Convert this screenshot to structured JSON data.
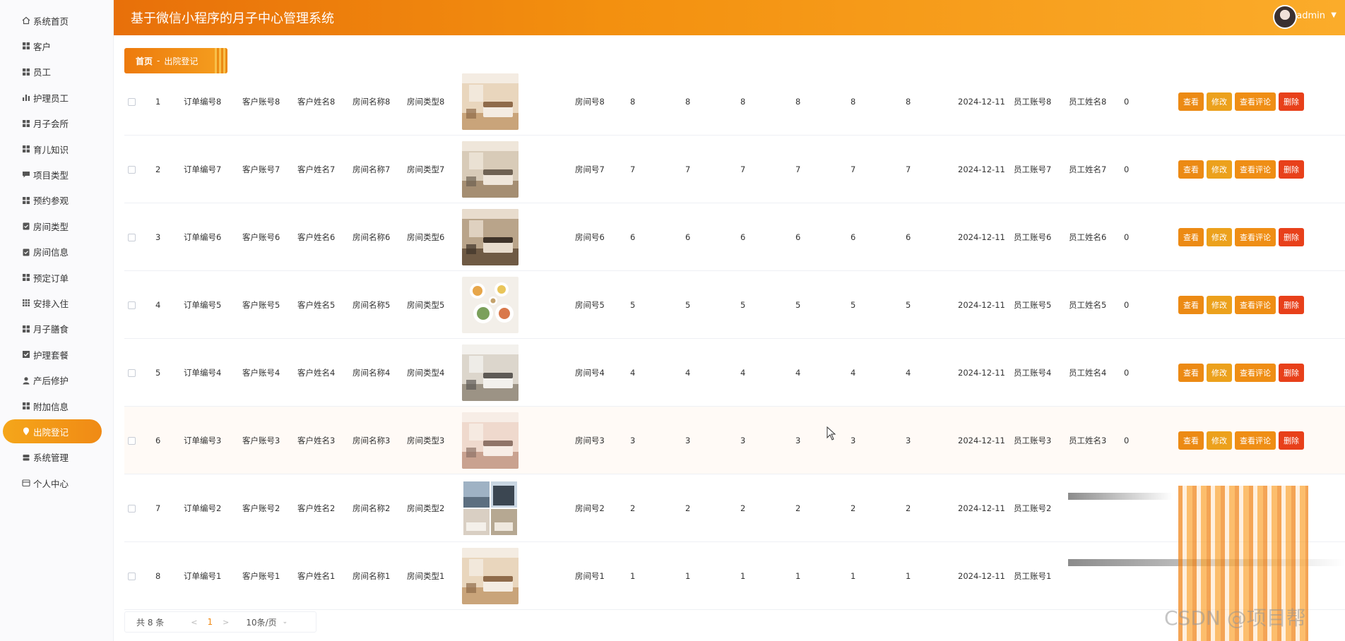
{
  "header": {
    "title": "基于微信小程序的月子中心管理系统",
    "user": "admin"
  },
  "sidebar": {
    "items": [
      {
        "label": "系统首页",
        "icon": "home-icon"
      },
      {
        "label": "客户",
        "icon": "grid-icon"
      },
      {
        "label": "员工",
        "icon": "grid-icon"
      },
      {
        "label": "护理员工",
        "icon": "bar-chart-icon"
      },
      {
        "label": "月子会所",
        "icon": "grid-icon"
      },
      {
        "label": "育儿知识",
        "icon": "grid-icon"
      },
      {
        "label": "项目类型",
        "icon": "chat-icon"
      },
      {
        "label": "预约参观",
        "icon": "grid-icon"
      },
      {
        "label": "房间类型",
        "icon": "clipboard-icon"
      },
      {
        "label": "房间信息",
        "icon": "clipboard-icon"
      },
      {
        "label": "预定订单",
        "icon": "grid-icon"
      },
      {
        "label": "安排入住",
        "icon": "grid9-icon"
      },
      {
        "label": "月子膳食",
        "icon": "grid-icon"
      },
      {
        "label": "护理套餐",
        "icon": "checkbox-icon"
      },
      {
        "label": "产后修护",
        "icon": "user-icon"
      },
      {
        "label": "附加信息",
        "icon": "grid-icon"
      },
      {
        "label": "出院登记",
        "icon": "pin-icon"
      },
      {
        "label": "系统管理",
        "icon": "server-icon"
      },
      {
        "label": "个人中心",
        "icon": "card-icon"
      }
    ],
    "active_index": 16
  },
  "breadcrumb": {
    "home": "首页",
    "separator": "-",
    "current": "出院登记"
  },
  "table": {
    "rows": [
      {
        "idx": "1",
        "order": "订单编号8",
        "acct": "客户账号8",
        "name": "客户姓名8",
        "room_name": "房间名称8",
        "room_type": "房间类型8",
        "room_no": "房间号8",
        "n1": "8",
        "n2": "8",
        "n3": "8",
        "n4": "8",
        "n5": "8",
        "n6": "8",
        "date": "2024-12-11",
        "staff_acct": "员工账号8",
        "staff_name": "员工姓名8",
        "status": "0",
        "img": "bedroom-warm"
      },
      {
        "idx": "2",
        "order": "订单编号7",
        "acct": "客户账号7",
        "name": "客户姓名7",
        "room_name": "房间名称7",
        "room_type": "房间类型7",
        "room_no": "房间号7",
        "n1": "7",
        "n2": "7",
        "n3": "7",
        "n4": "7",
        "n5": "7",
        "n6": "7",
        "date": "2024-12-11",
        "staff_acct": "员工账号7",
        "staff_name": "员工姓名7",
        "status": "0",
        "img": "living-room"
      },
      {
        "idx": "3",
        "order": "订单编号6",
        "acct": "客户账号6",
        "name": "客户姓名6",
        "room_name": "房间名称6",
        "room_type": "房间类型6",
        "room_no": "房间号6",
        "n1": "6",
        "n2": "6",
        "n3": "6",
        "n4": "6",
        "n5": "6",
        "n6": "6",
        "date": "2024-12-11",
        "staff_acct": "员工账号6",
        "staff_name": "员工姓名6",
        "status": "0",
        "img": "bedroom-dark"
      },
      {
        "idx": "4",
        "order": "订单编号5",
        "acct": "客户账号5",
        "name": "客户姓名5",
        "room_name": "房间名称5",
        "room_type": "房间类型5",
        "room_no": "房间号5",
        "n1": "5",
        "n2": "5",
        "n3": "5",
        "n4": "5",
        "n5": "5",
        "n6": "5",
        "date": "2024-12-11",
        "staff_acct": "员工账号5",
        "staff_name": "员工姓名5",
        "status": "0",
        "img": "meal"
      },
      {
        "idx": "5",
        "order": "订单编号4",
        "acct": "客户账号4",
        "name": "客户姓名4",
        "room_name": "房间名称4",
        "room_type": "房间类型4",
        "room_no": "房间号4",
        "n1": "4",
        "n2": "4",
        "n3": "4",
        "n4": "4",
        "n5": "4",
        "n6": "4",
        "date": "2024-12-11",
        "staff_acct": "员工账号4",
        "staff_name": "员工姓名4",
        "status": "0",
        "img": "bedroom-light"
      },
      {
        "idx": "6",
        "order": "订单编号3",
        "acct": "客户账号3",
        "name": "客户姓名3",
        "room_name": "房间名称3",
        "room_type": "房间类型3",
        "room_no": "房间号3",
        "n1": "3",
        "n2": "3",
        "n3": "3",
        "n4": "3",
        "n5": "3",
        "n6": "3",
        "date": "2024-12-11",
        "staff_acct": "员工账号3",
        "staff_name": "员工姓名3",
        "status": "0",
        "img": "room-pink"
      },
      {
        "idx": "7",
        "order": "订单编号2",
        "acct": "客户账号2",
        "name": "客户姓名2",
        "room_name": "房间名称2",
        "room_type": "房间类型2",
        "room_no": "房间号2",
        "n1": "2",
        "n2": "2",
        "n3": "2",
        "n4": "2",
        "n5": "2",
        "n6": "2",
        "date": "2024-12-11",
        "staff_acct": "员工账号2",
        "staff_name": "",
        "status": "",
        "img": "collage"
      },
      {
        "idx": "8",
        "order": "订单编号1",
        "acct": "客户账号1",
        "name": "客户姓名1",
        "room_name": "房间名称1",
        "room_type": "房间类型1",
        "room_no": "房间号1",
        "n1": "1",
        "n2": "1",
        "n3": "1",
        "n4": "1",
        "n5": "1",
        "n6": "1",
        "date": "2024-12-11",
        "staff_acct": "员工账号1",
        "staff_name": "",
        "status": "",
        "img": "bedroom-warm"
      }
    ],
    "buttons": {
      "view": "查看",
      "edit": "修改",
      "comment": "查看评论",
      "delete": "删除"
    },
    "visible_buttons_rows": 6
  },
  "pagination": {
    "total": "共 8 条",
    "prev": "<",
    "current": "1",
    "next": ">",
    "page_size": "10条/页"
  },
  "watermark": "CSDN @项目帮",
  "colors": {
    "accent": "#f08a15",
    "header_start": "#e8700a",
    "header_end": "#fbac2a",
    "danger": "#e8401a"
  }
}
